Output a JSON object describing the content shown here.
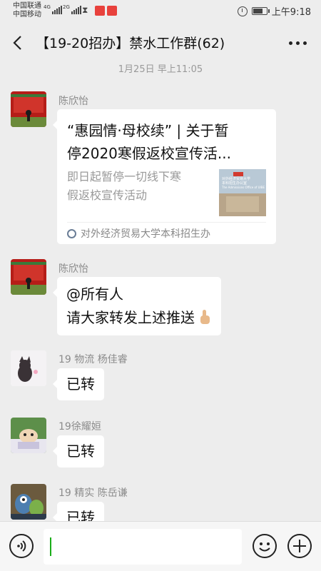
{
  "status_bar": {
    "carrier1": "中国联通",
    "carrier2": "中国移动",
    "net1": "4G",
    "net2": "2G",
    "time": "上午9:18"
  },
  "header": {
    "title": "【19-20招办】禁水工作群(62)"
  },
  "chat": {
    "timestamp": "1月25日 早上11:05",
    "messages": [
      {
        "sender": "陈欣怡",
        "type": "link",
        "title_line1": "“惠园情·母校续” | 关于暂",
        "title_line2": "停2020寒假返校宣传活...",
        "desc_line1": "即日起暂停一切线下寒",
        "desc_line2": "假返校宣传活动",
        "thumb_text1": "对外经济贸易大学",
        "thumb_text2": "本科招生办公室",
        "thumb_text3": "The Admissions Office of UIBE",
        "source": "对外经济贸易大学本科招生办"
      },
      {
        "sender": "陈欣怡",
        "type": "text",
        "line1": "@所有人",
        "line2": "请大家转发上述推送"
      },
      {
        "sender": "19 物流 杨佳睿",
        "type": "text",
        "text": "已转"
      },
      {
        "sender": "19徐耀姮",
        "type": "text",
        "text": "已转"
      },
      {
        "sender": "19 精实 陈岳谦",
        "type": "text",
        "text": "已转"
      }
    ]
  },
  "icons": {
    "back": "back-arrow-icon",
    "more": "more-dots-icon",
    "voice": "voice-icon",
    "emoji": "emoji-icon",
    "plus": "plus-icon"
  },
  "colors": {
    "background": "#ededed",
    "bubble": "#ffffff",
    "cursor": "#1aad19"
  }
}
